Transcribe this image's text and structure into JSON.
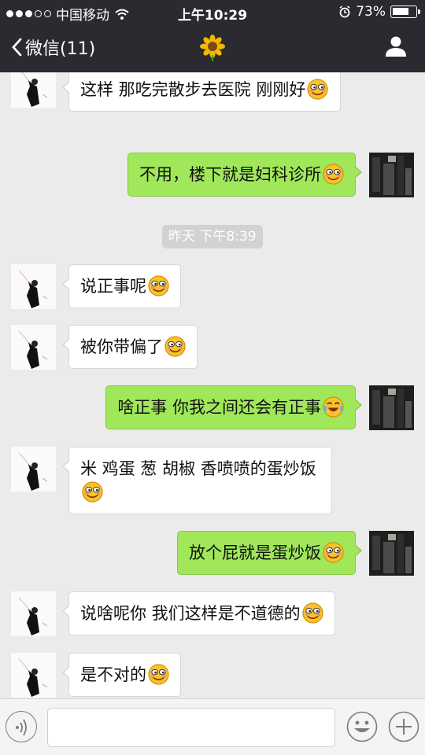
{
  "status_bar": {
    "carrier": "中国移动",
    "time": "上午10:29",
    "battery_percent": "73%",
    "battery_level": 0.73,
    "signal_bars_filled": 3,
    "signal_bars_total": 5
  },
  "nav": {
    "back_label": "微信(11)",
    "title_icon": "sunflower-icon",
    "profile_icon": "person-icon"
  },
  "messages": [
    {
      "side": "in",
      "text": "这样 那吃完散步去医院 刚刚好",
      "emoji": "grin-emoji"
    },
    {
      "side": "out",
      "text": "不用，楼下就是妇科诊所",
      "emoji": "grin-emoji"
    },
    {
      "type": "time",
      "text": "昨天 下午8:39"
    },
    {
      "side": "in",
      "text": "说正事呢",
      "emoji": "grin-emoji"
    },
    {
      "side": "in",
      "text": "被你带偏了",
      "emoji": "grin-emoji"
    },
    {
      "side": "out",
      "text": "啥正事 你我之间还会有正事",
      "emoji": "laugh-cry-emoji"
    },
    {
      "side": "in",
      "text": "米 鸡蛋 葱 胡椒 香喷喷的蛋炒饭",
      "emoji": "grin-emoji"
    },
    {
      "side": "out",
      "text": "放个屁就是蛋炒饭",
      "emoji": "grin-emoji"
    },
    {
      "side": "in",
      "text": "说啥呢你 我们这样是不道德的",
      "emoji": "grin-emoji"
    },
    {
      "side": "in",
      "text": "是不对的",
      "emoji": "grin-emoji"
    }
  ],
  "input_bar": {
    "voice_icon": "voice-icon",
    "emoji_icon": "smiley-icon",
    "plus_icon": "plus-icon",
    "input_value": ""
  },
  "colors": {
    "nav_bg": "#2b2a30",
    "chat_bg": "#ebebeb",
    "bubble_out": "#a0e75a",
    "bubble_in": "#ffffff"
  }
}
